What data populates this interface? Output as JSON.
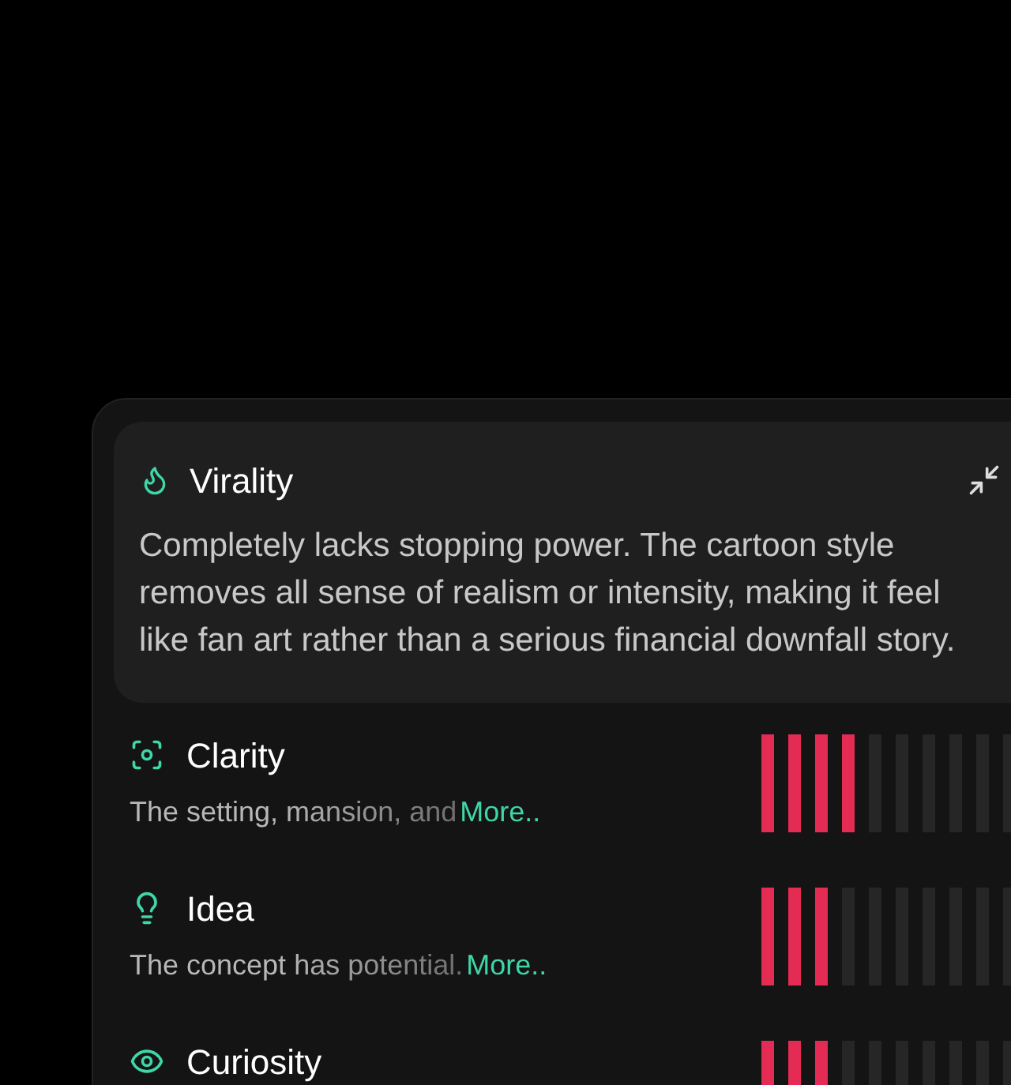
{
  "criteria": [
    {
      "title": "Virality",
      "expanded": true,
      "description": "Completely lacks stopping power. The cartoon style removes all sense of realism or intensity, making it feel like fan art rather than a serious financial downfall story."
    },
    {
      "title": "Clarity",
      "expanded": false,
      "description": "The setting, mansion, and",
      "more": "More..",
      "level": 0.4
    },
    {
      "title": "Idea",
      "expanded": false,
      "description": "The concept has potential.",
      "more": "More..",
      "level": 0.3
    },
    {
      "title": "Curiosity",
      "expanded": false,
      "level": 0.3
    }
  ]
}
